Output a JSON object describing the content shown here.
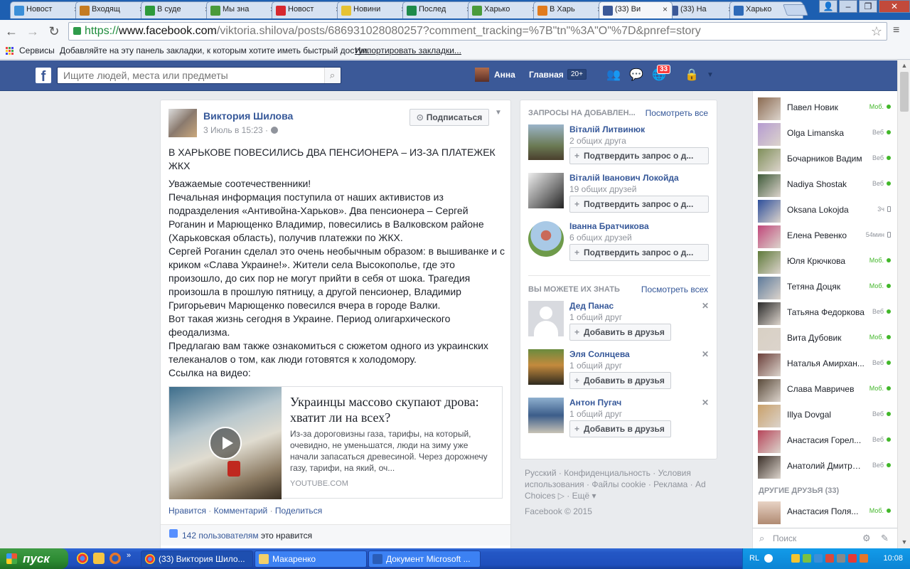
{
  "browser": {
    "tabs": [
      {
        "label": "Новост",
        "icon": "skype-news-icon",
        "color": "#3b8fd8"
      },
      {
        "label": "Входящ",
        "icon": "mail-icon",
        "color": "#c47b22"
      },
      {
        "label": "В суде",
        "icon": "news-icon",
        "color": "#2d9a3b"
      },
      {
        "label": "Мы зна",
        "icon": "gear-icon",
        "color": "#4a9b3b"
      },
      {
        "label": "Новост",
        "icon": "so-icon",
        "color": "#d7282f"
      },
      {
        "label": "Новини",
        "icon": "news-icon",
        "color": "#e6c233"
      },
      {
        "label": "Послед",
        "icon": "z-icon",
        "color": "#1e8a4a"
      },
      {
        "label": "Харько",
        "icon": "gear-icon",
        "color": "#4a9b3b"
      },
      {
        "label": "В Харь",
        "icon": "flame-icon",
        "color": "#e07b1e"
      },
      {
        "label": "(33) Ви",
        "icon": "facebook-icon",
        "color": "#3b5998"
      },
      {
        "label": "(33) На",
        "icon": "facebook-icon",
        "color": "#3b5998"
      },
      {
        "label": "Харько",
        "icon": "news-icon",
        "color": "#2e6ab8"
      }
    ],
    "url_scheme": "https://",
    "url_host": "www.facebook.com",
    "url_path": "/viktoria.shilova/posts/686931028080257?comment_tracking=%7B\"tn\"%3A\"O\"%7D&pnref=story",
    "bookmarks": {
      "services": "Сервисы",
      "hint": "Добавляйте на эту панель закладки, к которым хотите иметь быстрый доступ.",
      "import": "Импортировать закладки..."
    }
  },
  "fb": {
    "logo": "f",
    "search_placeholder": "Ищите людей, места или предметы",
    "user_name": "Анна",
    "home": "Главная",
    "home_count": "20+",
    "notif_count": "33"
  },
  "post": {
    "author": "Виктория Шилова",
    "date": "3 Июль в 15:23 ·",
    "subscribe": "Подписаться",
    "headline": "В ХАРЬКОВЕ ПОВЕСИЛИСЬ ДВА ПЕНСИОНЕРА – ИЗ-ЗА ПЛАТЕЖЕК ЖКХ",
    "paragraphs": [
      "Уважаемые соотечественники!",
      "Печальная информация поступила от наших активистов из подразделения «Антивойна-Харьков». Два пенсионера – Сергей Роганин и Марющенко Владимир, повесились в Валковском районе (Харьковская область), получив платежки по ЖКХ.",
      "Сергей Роганин сделал это очень необычным образом: в вышиванке и с криком «Слава Украине!». Жители села Высокополье, где это произошло, до сих пор не могут прийти в себя от шока. Трагедия произошла в прошлую пятницу, а другой пенсионер, Владимир Григорьевич Марющенко повесился вчера в городе Валки.",
      "Вот такая жизнь сегодня в Украине. Период олигархического феодализма.",
      "Предлагаю вам также ознакомиться с сюжетом одного из украинских телеканалов о том, как люди готовятся к холодомору.",
      "Ссылка на видео:"
    ],
    "link": {
      "title": "Украинцы массово скупают дрова: хватит ли на всех?",
      "description": "Из-за дороговизны газа, тарифы, на который, очевидно, не уменьшатся, люди на зиму уже начали запасаться древесиной. Через дорожнечу газу, тарифи, на який, оч...",
      "domain": "YOUTUBE.COM"
    },
    "actions": {
      "like": "Нравится",
      "comment": "Комментарий",
      "share": "Поделиться"
    },
    "likes_count": "142 пользователям",
    "likes_suffix": "это нравится"
  },
  "requests": {
    "header": "ЗАПРОСЫ НА ДОБАВЛЕН...",
    "see_all": "Посмотреть все",
    "items": [
      {
        "name": "Віталій Литвинюк",
        "mutual": "2 общих друга",
        "button": "Подтвердить запрос о д..."
      },
      {
        "name": "Віталій Іванович Локойда",
        "mutual": "19 общих друзей",
        "button": "Подтвердить запрос о д..."
      },
      {
        "name": "Іванна Братчикова",
        "mutual": "6 общих друзей",
        "button": "Подтвердить запрос о д..."
      }
    ]
  },
  "pymk": {
    "header": "ВЫ МОЖЕТЕ ИХ ЗНАТЬ",
    "see_all": "Посмотреть всех",
    "items": [
      {
        "name": "Дед Панас",
        "mutual": "1 общий друг",
        "button": "Добавить в друзья"
      },
      {
        "name": "Эля Солнцева",
        "mutual": "1 общий друг",
        "button": "Добавить в друзья"
      },
      {
        "name": "Антон Пугач",
        "mutual": "1 общий друг",
        "button": "Добавить в друзья"
      }
    ]
  },
  "footer": {
    "links": [
      "Русский",
      "Конфиденциальность",
      "Условия использования",
      "Файлы cookie",
      "Реклама",
      "Ad Choices",
      "Ещё"
    ],
    "copyright": "Facebook © 2015"
  },
  "chat": {
    "contacts": [
      {
        "name": "Павел Новик",
        "status": "Моб.",
        "kind": "mob"
      },
      {
        "name": "Olga Limanska",
        "status": "Веб",
        "kind": "web"
      },
      {
        "name": "Бочарников Вадим",
        "status": "Веб",
        "kind": "web"
      },
      {
        "name": "Nadiya Shostak",
        "status": "Веб",
        "kind": "web"
      },
      {
        "name": "Oksana Lokojda",
        "status": "3ч",
        "kind": "idle"
      },
      {
        "name": "Елена Ревенко",
        "status": "54мин",
        "kind": "idle"
      },
      {
        "name": "Юля Крючкова",
        "status": "Моб.",
        "kind": "mob"
      },
      {
        "name": "Тетяна Доцяк",
        "status": "Моб.",
        "kind": "mob"
      },
      {
        "name": "Татьяна Федоркова",
        "status": "Веб",
        "kind": "web"
      },
      {
        "name": "Вита Дубовик",
        "status": "Моб.",
        "kind": "mob"
      },
      {
        "name": "Наталья Амирхан...",
        "status": "Веб",
        "kind": "web"
      },
      {
        "name": "Слава Мавричев",
        "status": "Моб.",
        "kind": "mob"
      },
      {
        "name": "Illya Dovgal",
        "status": "Веб",
        "kind": "web"
      },
      {
        "name": "Анастасия Горел...",
        "status": "Веб",
        "kind": "web"
      },
      {
        "name": "Анатолий Дмитриев",
        "status": "Веб",
        "kind": "web"
      }
    ],
    "other_friends": "ДРУГИЕ ДРУЗЬЯ (33)",
    "other_contact": {
      "name": "Анастасия Поля...",
      "status": "Моб."
    },
    "search_placeholder": "Поиск"
  },
  "taskbar": {
    "start": "пуск",
    "buttons": [
      {
        "label": "(33) Виктория Шило...",
        "icon": "chrome-icon"
      },
      {
        "label": "Макаренко",
        "icon": "folder-icon"
      },
      {
        "label": "Документ Microsoft ...",
        "icon": "word-icon"
      }
    ],
    "lang": "RL",
    "clock": "10:08"
  }
}
